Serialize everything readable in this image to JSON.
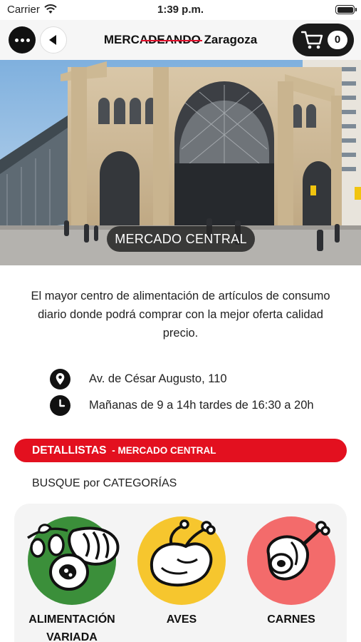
{
  "status_bar": {
    "carrier": "Carrier",
    "time": "1:39 p.m."
  },
  "nav": {
    "title_part1": "MERCADE",
    "title_part2": "ANDO",
    "title_part3": " Zaragoza",
    "cart_count": "0",
    "accent_color": "#e0102a"
  },
  "hero": {
    "label": "MERCADO CENTRAL"
  },
  "description": "El mayor centro de alimentación de artículos de consumo diario donde podrá comprar con la mejor oferta calidad precio.",
  "info": {
    "address": "Av. de César Augusto, 110",
    "hours": "Mañanas de 9 a 14h tardes de 16:30 a 20h",
    "address_icon": "location-pin-icon",
    "hours_icon": "clock-icon"
  },
  "banner": {
    "title": "DETALLISTAS",
    "subtitle": " - MERCADO CENTRAL",
    "color": "#e3101f"
  },
  "search_label": "BUSQUE por CATEGORÍAS",
  "categories": [
    {
      "label": "ALIMENTACIÓN VARIADA",
      "color": "#3b8f3a",
      "icon": "groceries-icon"
    },
    {
      "label": "AVES",
      "color": "#f6c62e",
      "icon": "chicken-icon"
    },
    {
      "label": "CARNES",
      "color": "#f36b6b",
      "icon": "ham-icon"
    }
  ]
}
